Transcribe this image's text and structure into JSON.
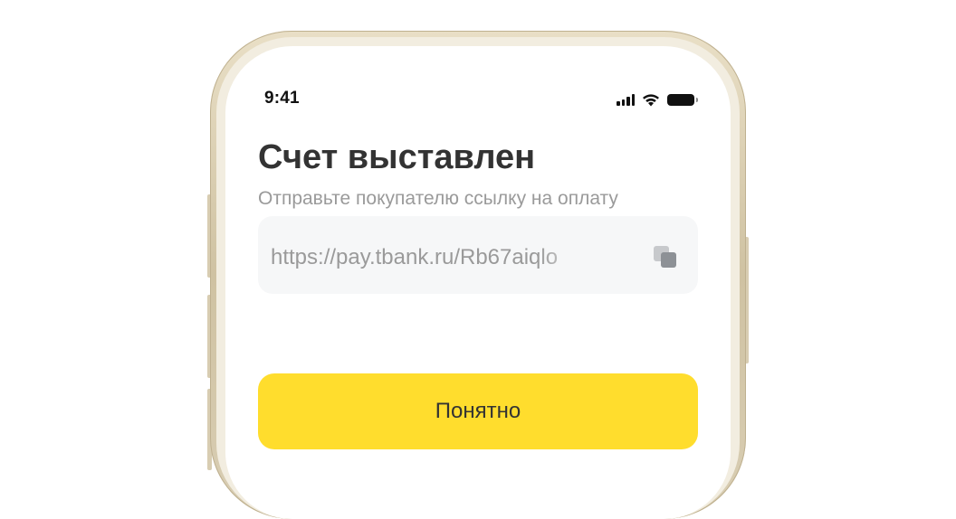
{
  "status_bar": {
    "time": "9:41",
    "icons": [
      "signal-icon",
      "wifi-icon",
      "battery-icon"
    ]
  },
  "screen": {
    "title": "Счет выставлен",
    "subtitle": "Отправьте покупателю ссылку на оплату",
    "link": {
      "value": "https://pay.tbank.ru/Rb67aiqlo",
      "copy_icon": "copy-icon"
    },
    "primary_button": {
      "label": "Понятно",
      "color": "#ffdd2d"
    }
  },
  "colors": {
    "accent_yellow": "#ffdd2d",
    "title_text": "#333333",
    "secondary_text": "#9a9a9a",
    "field_background": "#f6f7f8",
    "frame_gold": "#d8cdb2"
  }
}
